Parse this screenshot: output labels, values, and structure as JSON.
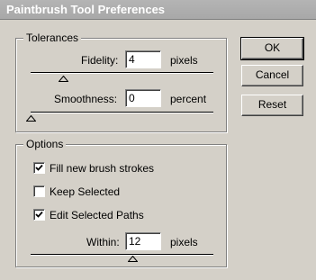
{
  "dialog": {
    "title": "Paintbrush Tool Preferences"
  },
  "tolerances": {
    "legend": "Tolerances",
    "fidelity": {
      "label": "Fidelity:",
      "value": "4",
      "unit": "pixels",
      "slider_value": 4,
      "slider_min": 0.5,
      "slider_max": 20
    },
    "smoothness": {
      "label": "Smoothness:",
      "value": "0",
      "unit": "percent",
      "slider_value": 0,
      "slider_min": 0,
      "slider_max": 100
    }
  },
  "options": {
    "legend": "Options",
    "fill_new_brush_strokes": {
      "label": "Fill new brush strokes",
      "checked": true
    },
    "keep_selected": {
      "label": "Keep Selected",
      "checked": false
    },
    "edit_selected_paths": {
      "label": "Edit Selected Paths",
      "checked": true
    },
    "within": {
      "label": "Within:",
      "value": "12",
      "unit": "pixels",
      "slider_value": 12,
      "slider_min": 2,
      "slider_max": 20
    }
  },
  "buttons": {
    "ok": "OK",
    "cancel": "Cancel",
    "reset": "Reset"
  }
}
